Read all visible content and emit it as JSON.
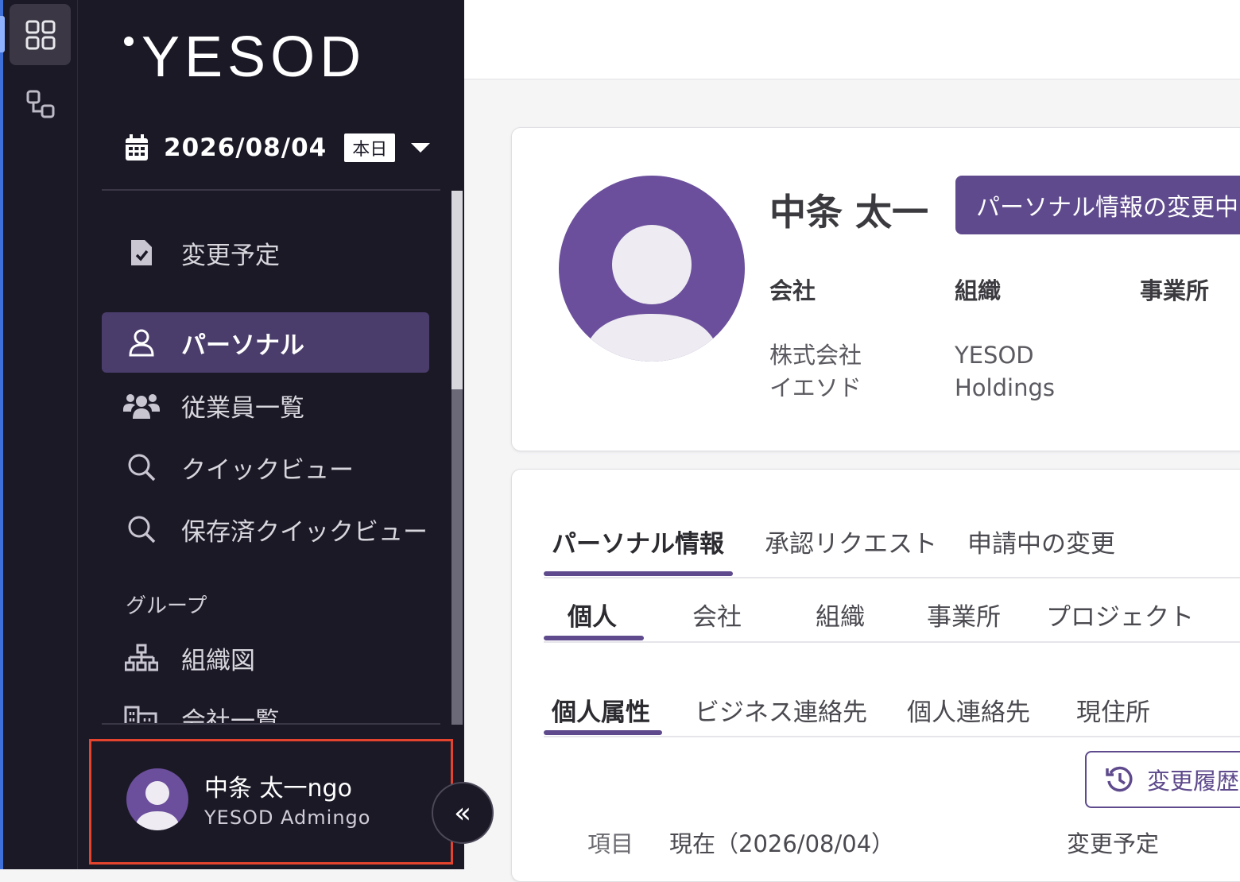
{
  "app": {
    "logo_text": "YESOD"
  },
  "date_picker": {
    "date": "2026/08/04",
    "today_label": "本日"
  },
  "sidebar": {
    "items": [
      {
        "label": "変更予定",
        "icon": "document-check-icon"
      },
      {
        "label": "パーソナル",
        "icon": "person-icon",
        "active": true
      },
      {
        "label": "従業員一覧",
        "icon": "people-icon"
      },
      {
        "label": "クイックビュー",
        "icon": "search-icon"
      },
      {
        "label": "保存済クイックビュー",
        "icon": "search-icon"
      }
    ],
    "group_label": "グループ",
    "group_items": [
      {
        "label": "組織図",
        "icon": "org-chart-icon"
      },
      {
        "label": "会社一覧",
        "icon": "building-icon"
      }
    ]
  },
  "user": {
    "name": "中条 太一ngo",
    "role": "YESOD Admingo"
  },
  "profile": {
    "name": "中条 太一",
    "badge": "パーソナル情報の変更中",
    "company_label": "会社",
    "company_value_line1": "株式会社",
    "company_value_line2": "イエソド",
    "org_label": "組織",
    "org_value_line1": "YESOD",
    "org_value_line2": "Holdings",
    "office_label": "事業所"
  },
  "tabs_primary": [
    "パーソナル情報",
    "承認リクエスト",
    "申請中の変更"
  ],
  "tabs_secondary": [
    "個人",
    "会社",
    "組織",
    "事業所",
    "プロジェクト"
  ],
  "tabs_tertiary": [
    "個人属性",
    "ビジネス連絡先",
    "個人連絡先",
    "現住所"
  ],
  "history_button": "変更履歴",
  "table_head": {
    "item": "項目",
    "current": "現在（2026/08/04）",
    "scheduled": "変更予定"
  },
  "colors": {
    "sidebar_bg": "#1c1926",
    "accent": "#5e4a8c",
    "active_nav": "#4a3d6b",
    "highlight_border": "#e4432d"
  }
}
